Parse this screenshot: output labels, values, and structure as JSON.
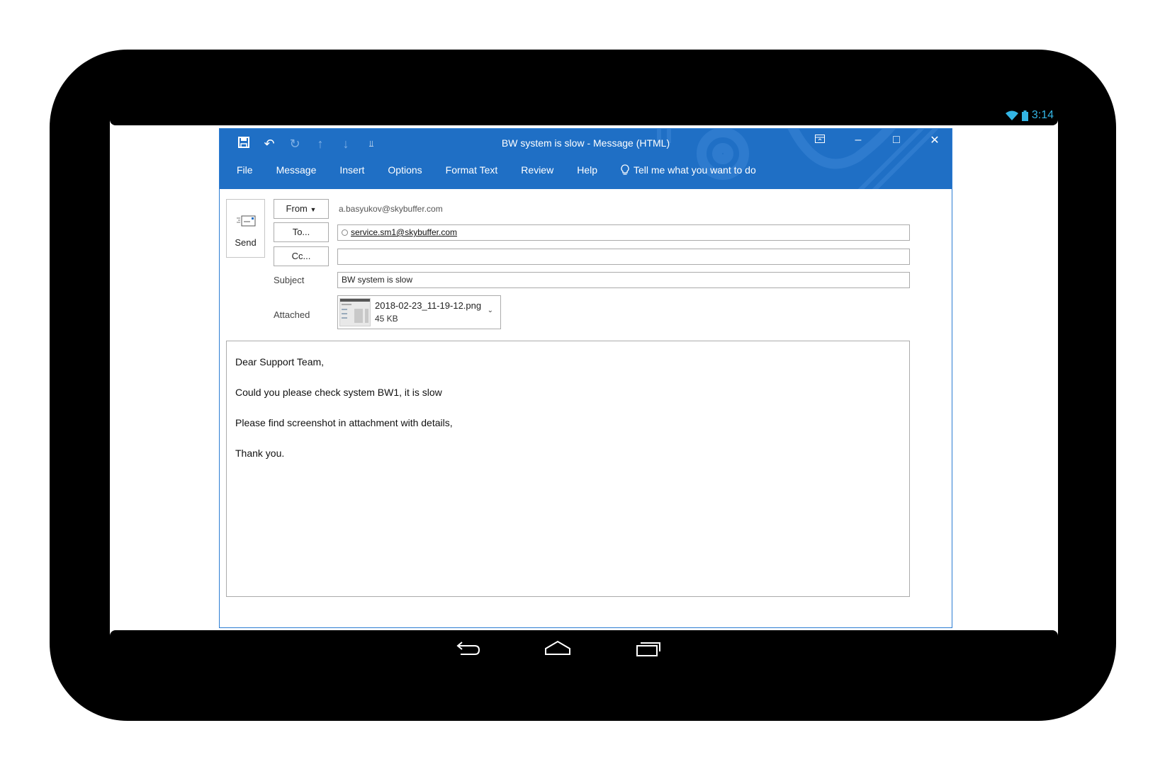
{
  "status": {
    "time": "3:14"
  },
  "window": {
    "title": "BW system is slow  -  Message (HTML)",
    "qat_icons": [
      "save-icon",
      "undo-icon",
      "redo-icon",
      "up-arrow-icon",
      "down-arrow-icon",
      "customize-icon"
    ],
    "controls": [
      "ribbon-display-icon",
      "minimize-icon",
      "maximize-icon",
      "close-icon"
    ]
  },
  "menu": {
    "items": [
      "File",
      "Message",
      "Insert",
      "Options",
      "Format Text",
      "Review",
      "Help"
    ],
    "tell_me": "Tell me what you want to do"
  },
  "compose": {
    "send_label": "Send",
    "from_label": "From",
    "from_value": "a.basyukov@skybuffer.com",
    "to_label": "To...",
    "to_value": "service.sm1@skybuffer.com",
    "cc_label": "Cc...",
    "cc_value": "",
    "subject_label": "Subject",
    "subject_value": "BW system is slow",
    "attached_label": "Attached",
    "attachment": {
      "name": "2018-02-23_11-19-12.png",
      "size": "45 KB"
    }
  },
  "message_body": [
    "Dear Support Team,",
    "Could you please check system BW1, it is slow",
    "Please find screenshot in attachment with details,",
    "Thank you."
  ],
  "colors": {
    "title_blue": "#1f6fc5",
    "status_blue": "#33b5e5"
  }
}
